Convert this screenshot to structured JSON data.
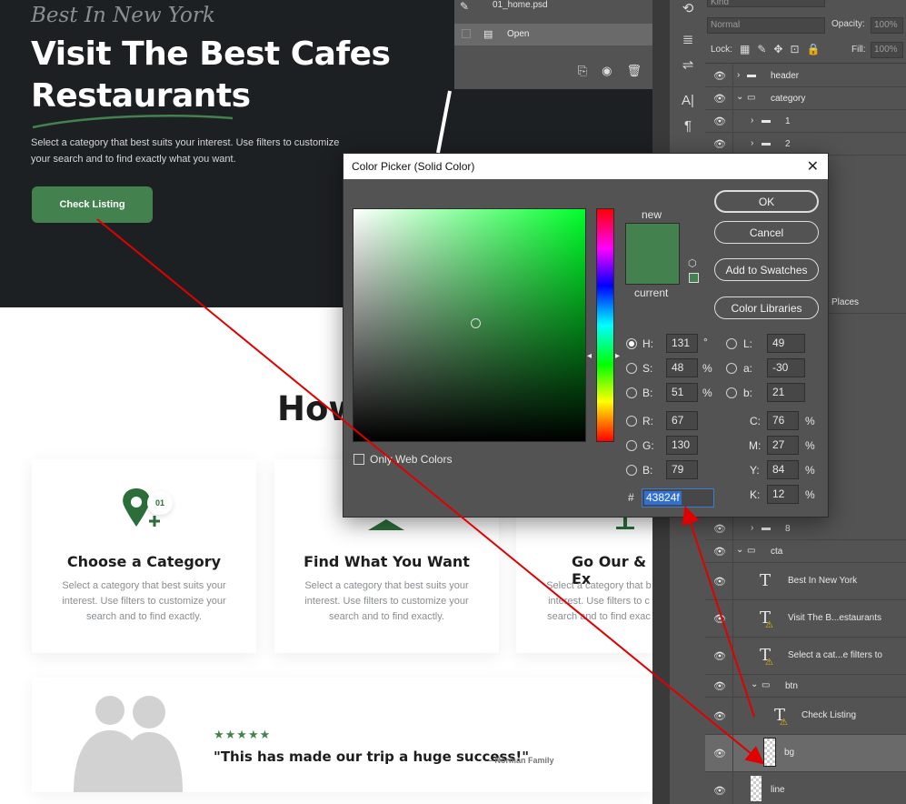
{
  "website": {
    "script_title": "Best In New York",
    "hero_title_line1": "Visit The Best Cafes",
    "hero_title_line2": "Restaurants",
    "hero_desc": "Select a category that best suits your interest. Use filters to customize your search and to find exactly what you want.",
    "cta_label": "Check Listing",
    "how_title": "How",
    "cards": [
      {
        "title": "Choose a Category",
        "desc": "Select a category that best suits your interest. Use filters to customize your search and to find exactly.",
        "badge": "01"
      },
      {
        "title": "Find What You Want",
        "desc": "Select a category that best suits your interest. Use filters to customize your search and to find exactly."
      },
      {
        "title": "Go Our & Ex",
        "desc": "Select a category that b interest. Use filters to c search and to find exac"
      }
    ],
    "testimonial": {
      "stars": "★★★★★",
      "quote": "\"This has made our trip a huge success!\"",
      "author": "– Norman Family"
    },
    "accent_color": "#43824f",
    "dark_bg": "#1d2022"
  },
  "history_panel": {
    "document": "01_home.psd",
    "state": "Open"
  },
  "layers_panel": {
    "kind_placeholder": "Kind",
    "blend_mode": "Normal",
    "opacity_label": "Opacity:",
    "opacity_value": "100%",
    "lock_label": "Lock:",
    "fill_label": "Fill:",
    "fill_value": "100%",
    "layers": {
      "header": "header",
      "category": "category",
      "g1": "1",
      "g2": "2",
      "places": "Places",
      "g8": "8",
      "cta": "cta",
      "best": "Best In New York",
      "visit": "Visit The B...estaurants",
      "select": "Select a cat...e filters to",
      "btn": "btn",
      "check": "Check Listing",
      "bg": "bg",
      "line": "line"
    }
  },
  "color_picker": {
    "title": "Color Picker (Solid Color)",
    "new_label": "new",
    "current_label": "current",
    "new_color": "#43824f",
    "current_color": "#43824f",
    "buttons": {
      "ok": "OK",
      "cancel": "Cancel",
      "add_to_swatches": "Add to Swatches",
      "color_libraries": "Color Libraries"
    },
    "only_web_colors": "Only Web Colors",
    "hsb": {
      "h": "131",
      "s": "48",
      "b": "51"
    },
    "rgb": {
      "r": "67",
      "g": "130",
      "b": "79"
    },
    "lab": {
      "l": "49",
      "a": "-30",
      "b": "21"
    },
    "cmyk": {
      "c": "76",
      "m": "27",
      "y": "84",
      "k": "12"
    },
    "hex": "43824f",
    "labels": {
      "h": "H:",
      "s": "S:",
      "b": "B:",
      "r": "R:",
      "g": "G:",
      "b2": "B:",
      "l": "L:",
      "a": "a:",
      "lb": "b:",
      "c": "C:",
      "m": "M:",
      "y": "Y:",
      "k": "K:",
      "deg": "°",
      "pct": "%",
      "hash": "#"
    }
  }
}
